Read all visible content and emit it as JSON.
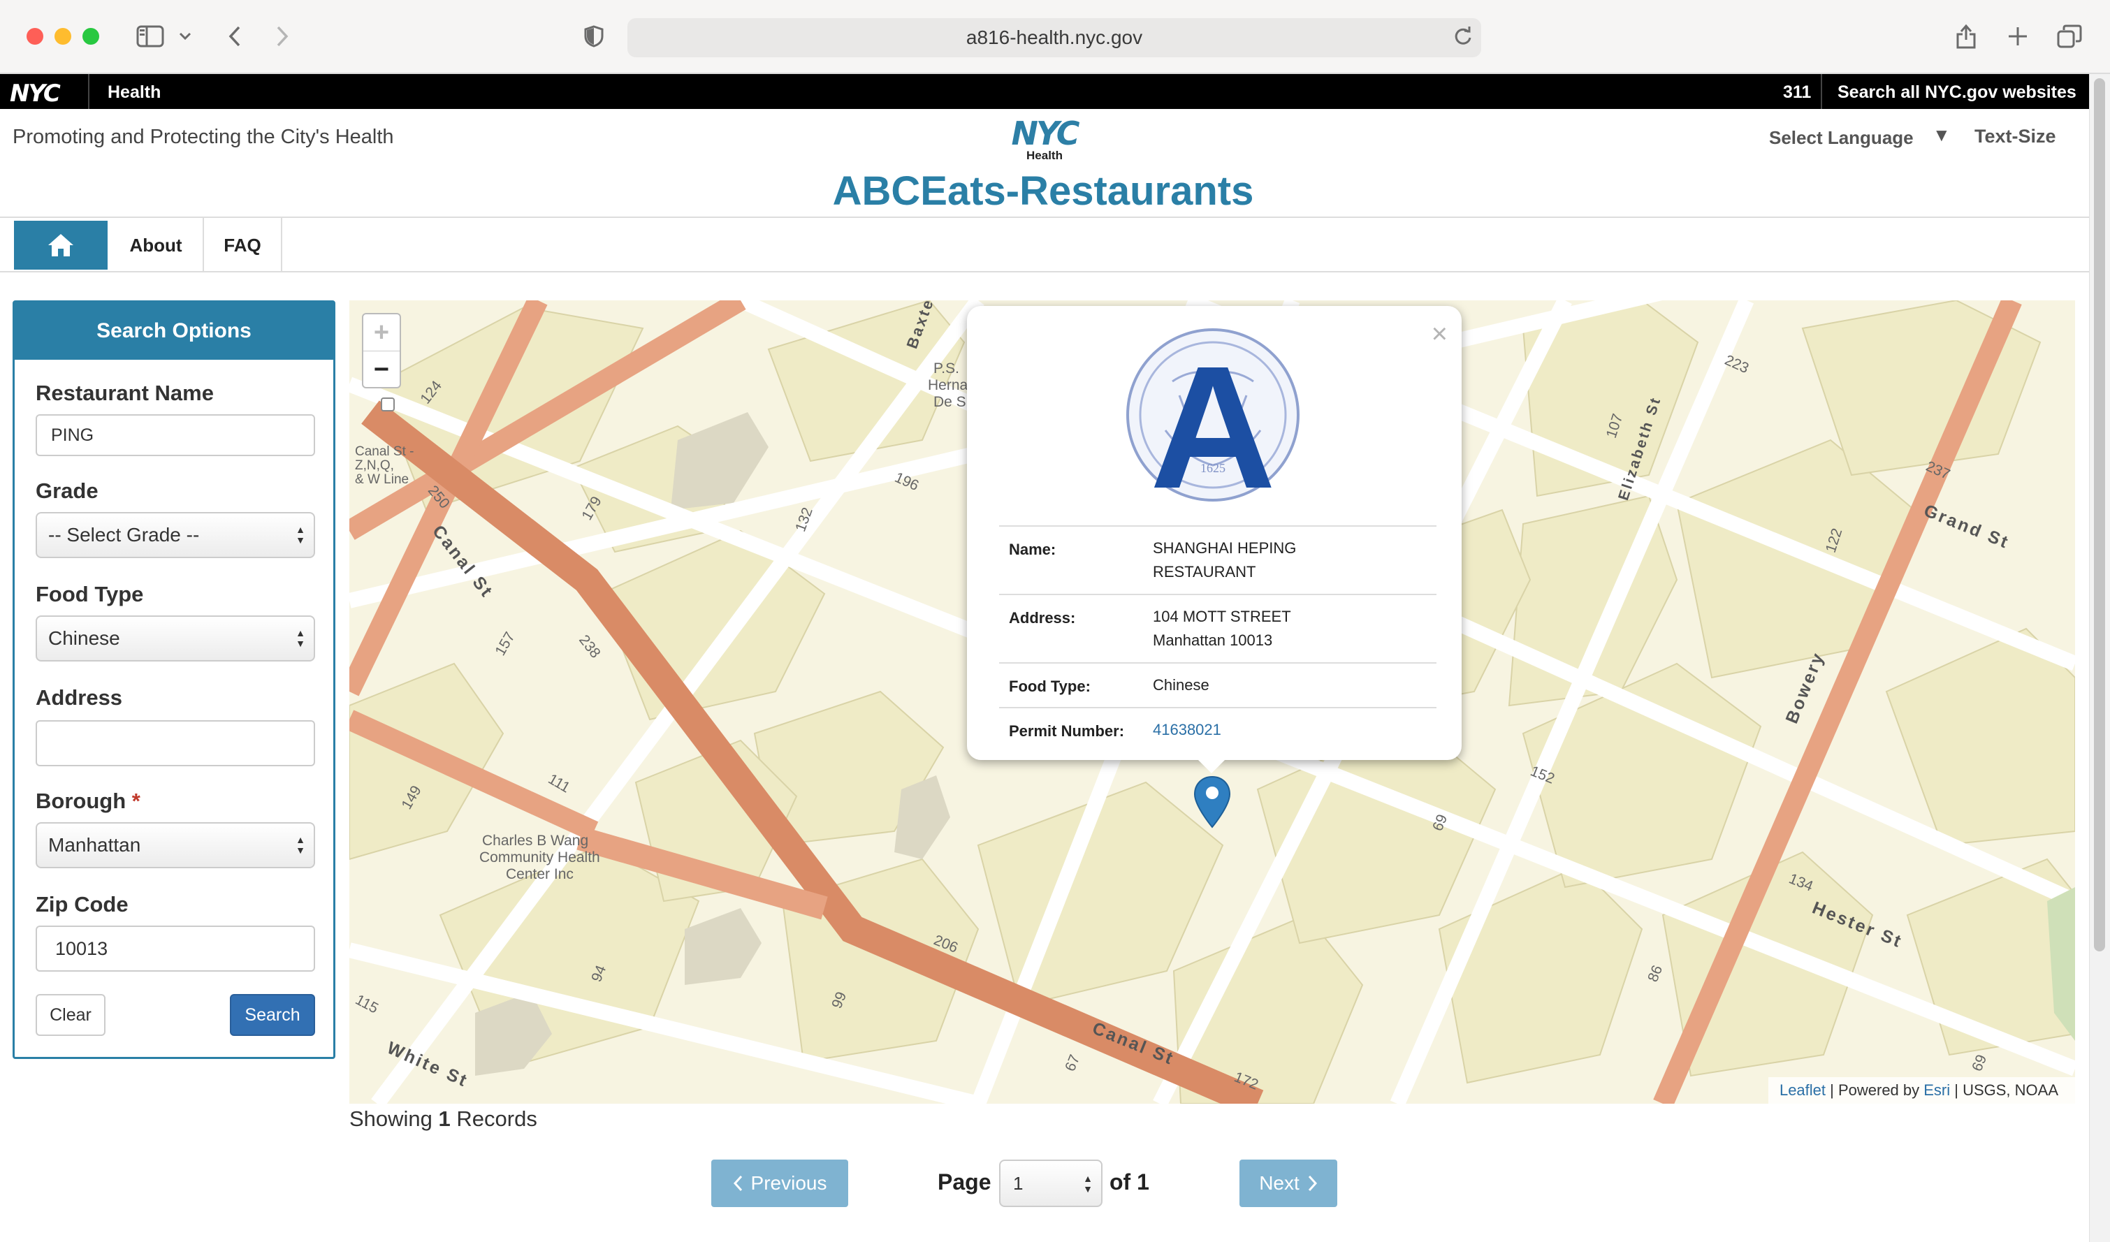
{
  "browser": {
    "url": "a816-health.nyc.gov"
  },
  "nycbar": {
    "logo": "NYC",
    "section": "Health",
    "link_311": "311",
    "link_search": "Search all NYC.gov websites"
  },
  "header": {
    "tagline": "Promoting and Protecting the City's Health",
    "logo_big": "NYC",
    "logo_small": "Health",
    "title": "ABCEats-Restaurants",
    "language": "Select Language",
    "language_caret": "▼",
    "text_size": "Text-Size"
  },
  "nav": {
    "items": [
      {
        "label": "About"
      },
      {
        "label": "FAQ"
      }
    ]
  },
  "search": {
    "title": "Search Options",
    "restaurant_name": {
      "label": "Restaurant Name",
      "value": "PING"
    },
    "grade": {
      "label": "Grade",
      "value": "-- Select Grade --"
    },
    "food_type": {
      "label": "Food Type",
      "value": "Chinese"
    },
    "address": {
      "label": "Address",
      "value": ""
    },
    "borough": {
      "label": "Borough",
      "required_mark": "*",
      "value": "Manhattan"
    },
    "zip": {
      "label": "Zip Code",
      "value": "10013"
    },
    "clear_label": "Clear",
    "search_label": "Search"
  },
  "map": {
    "zoom_in": "+",
    "zoom_out": "−",
    "close": "×",
    "attribution": {
      "leaflet": "Leaflet",
      "powered": " | Powered by ",
      "esri": "Esri",
      "rest": " | USGS, NOAA"
    },
    "streets": [
      "Canal St",
      "Canal St",
      "Hester St",
      "Grand St",
      "Bowery",
      "Elizabeth St",
      "White St",
      "Baxte"
    ],
    "labels": [
      "Charles B Wang",
      "Community Health",
      "Center Inc",
      "P.S.",
      "Herna",
      "De S",
      "Canal St -",
      "Z,N,Q,",
      "& W Line"
    ],
    "numbers": [
      "124",
      "179",
      "250",
      "157",
      "238",
      "149",
      "111",
      "94",
      "115",
      "99",
      "206",
      "67",
      "172",
      "69",
      "152",
      "134",
      "86",
      "122",
      "237",
      "223",
      "107",
      "196",
      "132",
      "69"
    ],
    "popup": {
      "grade": "A",
      "seal_year": "1625",
      "rows": [
        {
          "key": "Name:",
          "value_line1": "SHANGHAI HEPING",
          "value_line2": "RESTAURANT"
        },
        {
          "key": "Address:",
          "value_line1": "104 MOTT STREET",
          "value_line2": "Manhattan 10013"
        },
        {
          "key": "Food Type:",
          "value_line1": "Chinese"
        },
        {
          "key": "Permit Number:",
          "value_line1": "41638021"
        }
      ]
    }
  },
  "results": {
    "prefix": "Showing",
    "count": "1",
    "suffix": "Records"
  },
  "pager": {
    "previous": "Previous",
    "page_label": "Page",
    "page_value": "1",
    "of_label": "of 1",
    "next": "Next"
  },
  "colors": {
    "brand": "#2a7fa6",
    "search_button": "#3270b3",
    "pager_button": "#7fb3d1",
    "major_road": "#e09a76",
    "building": "#f0ecc9"
  }
}
